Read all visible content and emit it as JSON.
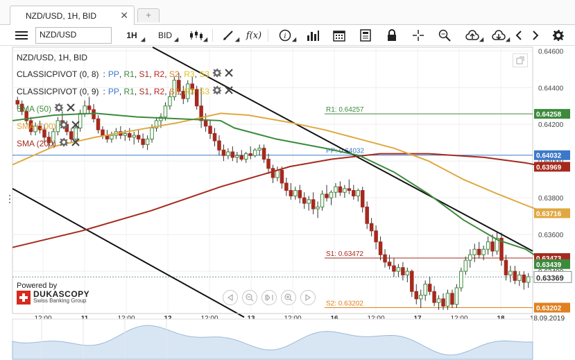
{
  "tab": {
    "label": "NZD/USD, 1H, BID",
    "add_label": "+"
  },
  "toolbar": {
    "instrument": "NZD/USD",
    "period": "1H",
    "side": "BID",
    "fx_label": "f(x)"
  },
  "legend": {
    "title": "NZD/USD, 1H, BID",
    "pivots": [
      {
        "name": "CLASSICPIVOT (0, 8)",
        "items": [
          "PP",
          "R1",
          "S1",
          "R2",
          "S2",
          "R3",
          "S3"
        ]
      },
      {
        "name": "CLASSICPIVOT (0, 9)",
        "items": [
          "PP",
          "R1",
          "S1",
          "R2",
          "S2",
          "R3",
          "S3"
        ]
      }
    ],
    "pivot_sep": ":",
    "smas": [
      {
        "name": "SMA (50)",
        "color": "#3c8a3c"
      },
      {
        "name": "SMA (100)",
        "color": "#e0a840"
      },
      {
        "name": "SMA (200)",
        "color": "#a52a1e"
      }
    ]
  },
  "branding": {
    "powered_by": "Powered by",
    "name": "DUKASCOPY",
    "sub": "Swiss Banking Group"
  },
  "colors": {
    "pp": "#3b78c9",
    "r1": "#3c8a3c",
    "s1": "#a52a1e",
    "r2": "#c02020",
    "s2": "#e08020",
    "r3": "#e0c020",
    "s3": "#e0c020",
    "bull": "#3c8a3c",
    "bear": "#a52a1e",
    "wick": "#333333"
  },
  "chart_data": {
    "type": "candlestick",
    "ylim": [
      0.6317,
      0.6462
    ],
    "y_ticks": [
      "0.64600",
      "0.64400",
      "0.64200",
      "0.64000",
      "0.63800",
      "0.63600",
      "0.63400"
    ],
    "x_tick_labels": [
      {
        "label": "12:00",
        "bold": false
      },
      {
        "label": "11",
        "bold": true
      },
      {
        "label": "12:00",
        "bold": false
      },
      {
        "label": "12",
        "bold": true
      },
      {
        "label": "12:00",
        "bold": false
      },
      {
        "label": "13",
        "bold": true
      },
      {
        "label": "12:00",
        "bold": false
      },
      {
        "label": "16",
        "bold": true
      },
      {
        "label": "12:00",
        "bold": false
      },
      {
        "label": "17",
        "bold": true
      },
      {
        "label": "12:00",
        "bold": false
      },
      {
        "label": "18",
        "bold": true
      },
      {
        "label": "18.09.2019",
        "bold": false
      }
    ],
    "levels": [
      {
        "label": "R1: 0.64257",
        "value": 0.64257,
        "color": "#3c8a3c",
        "badge": "0.64258"
      },
      {
        "label": "PP: 0.64032",
        "value": 0.64032,
        "color": "#3b78c9",
        "badge": "0.64032"
      },
      {
        "label": "S1: 0.63472",
        "value": 0.63472,
        "color": "#a52a1e",
        "badge": "0.63473"
      },
      {
        "label": "S2: 0.63202",
        "value": 0.63202,
        "color": "#e08020",
        "badge": "0.63202"
      }
    ],
    "series_badges": [
      {
        "value": 0.63969,
        "text": "0.63969",
        "color": "#a52a1e"
      },
      {
        "value": 0.63716,
        "text": "0.63716",
        "color": "#e0a840"
      },
      {
        "value": 0.63439,
        "text": "0.63439",
        "color": "#3c8a3c"
      }
    ],
    "last_price": {
      "value": 0.63369,
      "text": "0.63369"
    },
    "sma50_path": [
      [
        0,
        0.6422
      ],
      [
        60,
        0.6425
      ],
      [
        120,
        0.6426
      ],
      [
        180,
        0.6424
      ],
      [
        240,
        0.6423
      ],
      [
        300,
        0.6422
      ],
      [
        320,
        0.6418
      ],
      [
        380,
        0.6412
      ],
      [
        450,
        0.6407
      ],
      [
        500,
        0.6403
      ],
      [
        550,
        0.6394
      ],
      [
        600,
        0.6382
      ],
      [
        650,
        0.6368
      ],
      [
        700,
        0.6357
      ],
      [
        740,
        0.6352
      ],
      [
        768,
        0.6345
      ]
    ],
    "sma100_path": [
      [
        0,
        0.6398
      ],
      [
        60,
        0.6408
      ],
      [
        120,
        0.6413
      ],
      [
        180,
        0.6417
      ],
      [
        240,
        0.6421
      ],
      [
        300,
        0.6426
      ],
      [
        340,
        0.6425
      ],
      [
        400,
        0.6421
      ],
      [
        450,
        0.6417
      ],
      [
        500,
        0.6412
      ],
      [
        550,
        0.6407
      ],
      [
        600,
        0.64
      ],
      [
        650,
        0.639
      ],
      [
        700,
        0.6382
      ],
      [
        740,
        0.6376
      ],
      [
        768,
        0.6372
      ]
    ],
    "sma200_path": [
      [
        0,
        0.6353
      ],
      [
        100,
        0.6362
      ],
      [
        200,
        0.6373
      ],
      [
        300,
        0.6386
      ],
      [
        400,
        0.6397
      ],
      [
        460,
        0.6401
      ],
      [
        530,
        0.6404
      ],
      [
        600,
        0.6404
      ],
      [
        680,
        0.6402
      ],
      [
        740,
        0.6399
      ],
      [
        768,
        0.6397
      ]
    ],
    "trendline_upper": [
      [
        220,
        0.6462
      ],
      [
        768,
        0.6351
      ]
    ],
    "trendline_lower": [
      [
        18,
        0.6385
      ],
      [
        352,
        0.6315
      ]
    ],
    "candles": [
      [
        0.6433,
        0.6435,
        0.6428,
        0.6431
      ],
      [
        0.6431,
        0.6433,
        0.6425,
        0.6427
      ],
      [
        0.6427,
        0.6429,
        0.642,
        0.6422
      ],
      [
        0.6422,
        0.6424,
        0.6414,
        0.6416
      ],
      [
        0.6416,
        0.6421,
        0.6414,
        0.6419
      ],
      [
        0.6419,
        0.6422,
        0.6415,
        0.6417
      ],
      [
        0.6417,
        0.642,
        0.641,
        0.6413
      ],
      [
        0.6413,
        0.6416,
        0.6407,
        0.641
      ],
      [
        0.641,
        0.6418,
        0.6408,
        0.6416
      ],
      [
        0.6416,
        0.6424,
        0.6414,
        0.6422
      ],
      [
        0.6422,
        0.6427,
        0.6418,
        0.642
      ],
      [
        0.642,
        0.6422,
        0.6414,
        0.6416
      ],
      [
        0.6416,
        0.6418,
        0.641,
        0.6412
      ],
      [
        0.6412,
        0.642,
        0.641,
        0.6418
      ],
      [
        0.6418,
        0.6428,
        0.6416,
        0.6426
      ],
      [
        0.6426,
        0.6433,
        0.6424,
        0.643
      ],
      [
        0.643,
        0.6435,
        0.6426,
        0.6428
      ],
      [
        0.6428,
        0.6431,
        0.6421,
        0.6423
      ],
      [
        0.6423,
        0.6425,
        0.6415,
        0.6417
      ],
      [
        0.6417,
        0.6419,
        0.6412,
        0.6414
      ],
      [
        0.6414,
        0.6417,
        0.641,
        0.6412
      ],
      [
        0.6412,
        0.6416,
        0.641,
        0.6414
      ],
      [
        0.6414,
        0.6418,
        0.6412,
        0.6416
      ],
      [
        0.6416,
        0.6419,
        0.6412,
        0.6414
      ],
      [
        0.6414,
        0.6417,
        0.6411,
        0.6415
      ],
      [
        0.6415,
        0.6418,
        0.6411,
        0.6413
      ],
      [
        0.6413,
        0.6416,
        0.6409,
        0.6414
      ],
      [
        0.6414,
        0.6417,
        0.641,
        0.6412
      ],
      [
        0.6412,
        0.6415,
        0.6407,
        0.6409
      ],
      [
        0.6409,
        0.6414,
        0.6406,
        0.6412
      ],
      [
        0.6412,
        0.642,
        0.641,
        0.6418
      ],
      [
        0.6418,
        0.6424,
        0.6416,
        0.6422
      ],
      [
        0.6422,
        0.6426,
        0.6418,
        0.6424
      ],
      [
        0.6424,
        0.6432,
        0.6422,
        0.643
      ],
      [
        0.643,
        0.6438,
        0.6428,
        0.6435
      ],
      [
        0.6435,
        0.6446,
        0.6433,
        0.6444
      ],
      [
        0.6444,
        0.6448,
        0.6436,
        0.6438
      ],
      [
        0.6438,
        0.6441,
        0.6431,
        0.6434
      ],
      [
        0.6434,
        0.6444,
        0.6432,
        0.6442
      ],
      [
        0.6442,
        0.6446,
        0.6436,
        0.6439
      ],
      [
        0.6439,
        0.6441,
        0.6428,
        0.643
      ],
      [
        0.643,
        0.644,
        0.6418,
        0.6422
      ],
      [
        0.6422,
        0.6426,
        0.6416,
        0.6419
      ],
      [
        0.6419,
        0.6422,
        0.6412,
        0.6415
      ],
      [
        0.6415,
        0.6418,
        0.6408,
        0.6411
      ],
      [
        0.6411,
        0.6414,
        0.6403,
        0.6406
      ],
      [
        0.6406,
        0.6409,
        0.64,
        0.6403
      ],
      [
        0.6403,
        0.6407,
        0.6401,
        0.6405
      ],
      [
        0.6405,
        0.6408,
        0.64,
        0.6402
      ],
      [
        0.6402,
        0.6405,
        0.6399,
        0.6403
      ],
      [
        0.6403,
        0.6406,
        0.64,
        0.6401
      ],
      [
        0.6401,
        0.6405,
        0.6399,
        0.6404
      ],
      [
        0.6404,
        0.6408,
        0.6401,
        0.6403
      ],
      [
        0.6403,
        0.6407,
        0.6402,
        0.6406
      ],
      [
        0.6406,
        0.6409,
        0.6403,
        0.6407
      ],
      [
        0.6407,
        0.6409,
        0.6399,
        0.6401
      ],
      [
        0.6401,
        0.6404,
        0.6393,
        0.6396
      ],
      [
        0.6396,
        0.6398,
        0.6388,
        0.6391
      ],
      [
        0.6391,
        0.6397,
        0.6389,
        0.6395
      ],
      [
        0.6395,
        0.6397,
        0.6385,
        0.6388
      ],
      [
        0.6388,
        0.6391,
        0.6381,
        0.6384
      ],
      [
        0.6384,
        0.6388,
        0.6379,
        0.6381
      ],
      [
        0.6381,
        0.6386,
        0.6379,
        0.6384
      ],
      [
        0.6384,
        0.6387,
        0.6377,
        0.638
      ],
      [
        0.638,
        0.6383,
        0.6374,
        0.6377
      ],
      [
        0.6377,
        0.6381,
        0.6373,
        0.6379
      ],
      [
        0.6379,
        0.6383,
        0.6371,
        0.6374
      ],
      [
        0.6374,
        0.6378,
        0.6369,
        0.6375
      ],
      [
        0.6375,
        0.6384,
        0.6373,
        0.6382
      ],
      [
        0.6382,
        0.6387,
        0.6378,
        0.638
      ],
      [
        0.638,
        0.6384,
        0.6376,
        0.6383
      ],
      [
        0.6383,
        0.6388,
        0.638,
        0.6386
      ],
      [
        0.6386,
        0.6389,
        0.6381,
        0.6383
      ],
      [
        0.6383,
        0.6387,
        0.638,
        0.6385
      ],
      [
        0.6385,
        0.639,
        0.6382,
        0.6384
      ],
      [
        0.6384,
        0.6387,
        0.6379,
        0.6381
      ],
      [
        0.6381,
        0.6385,
        0.6378,
        0.6384
      ],
      [
        0.6384,
        0.6386,
        0.6372,
        0.6375
      ],
      [
        0.6375,
        0.6378,
        0.6363,
        0.6366
      ],
      [
        0.6366,
        0.6369,
        0.6359,
        0.6362
      ],
      [
        0.6362,
        0.6365,
        0.6352,
        0.6356
      ],
      [
        0.6356,
        0.6359,
        0.6346,
        0.6349
      ],
      [
        0.6349,
        0.6352,
        0.6342,
        0.6345
      ],
      [
        0.6345,
        0.6349,
        0.6341,
        0.6343
      ],
      [
        0.6343,
        0.6347,
        0.6337,
        0.634
      ],
      [
        0.634,
        0.6344,
        0.6337,
        0.6342
      ],
      [
        0.6342,
        0.6345,
        0.6335,
        0.6338
      ],
      [
        0.6338,
        0.6342,
        0.6334,
        0.634
      ],
      [
        0.634,
        0.6341,
        0.6326,
        0.6329
      ],
      [
        0.6329,
        0.6333,
        0.6322,
        0.6325
      ],
      [
        0.6325,
        0.633,
        0.632,
        0.6327
      ],
      [
        0.6327,
        0.6335,
        0.6324,
        0.6333
      ],
      [
        0.6333,
        0.6337,
        0.6327,
        0.6329
      ],
      [
        0.6329,
        0.6332,
        0.6321,
        0.6323
      ],
      [
        0.6323,
        0.6327,
        0.6319,
        0.6325
      ],
      [
        0.6325,
        0.6328,
        0.6319,
        0.6321
      ],
      [
        0.6321,
        0.633,
        0.6319,
        0.6328
      ],
      [
        0.6328,
        0.633,
        0.632,
        0.6322
      ],
      [
        0.6322,
        0.6333,
        0.632,
        0.6331
      ],
      [
        0.6331,
        0.6342,
        0.6329,
        0.634
      ],
      [
        0.634,
        0.6348,
        0.6338,
        0.6346
      ],
      [
        0.6346,
        0.6352,
        0.6342,
        0.6349
      ],
      [
        0.6349,
        0.6355,
        0.6345,
        0.6352
      ],
      [
        0.6352,
        0.6356,
        0.6347,
        0.6349
      ],
      [
        0.6349,
        0.6354,
        0.6346,
        0.6352
      ],
      [
        0.6352,
        0.6359,
        0.6349,
        0.6356
      ],
      [
        0.6356,
        0.636,
        0.6348,
        0.6351
      ],
      [
        0.6351,
        0.6361,
        0.6349,
        0.6358
      ],
      [
        0.6358,
        0.6361,
        0.6343,
        0.6346
      ],
      [
        0.6346,
        0.6349,
        0.6335,
        0.6338
      ],
      [
        0.6338,
        0.6343,
        0.6334,
        0.634
      ],
      [
        0.634,
        0.6343,
        0.6333,
        0.6335
      ],
      [
        0.6335,
        0.634,
        0.6332,
        0.6338
      ],
      [
        0.6338,
        0.634,
        0.633,
        0.6334
      ],
      [
        0.6334,
        0.6339,
        0.6331,
        0.6337
      ]
    ]
  }
}
